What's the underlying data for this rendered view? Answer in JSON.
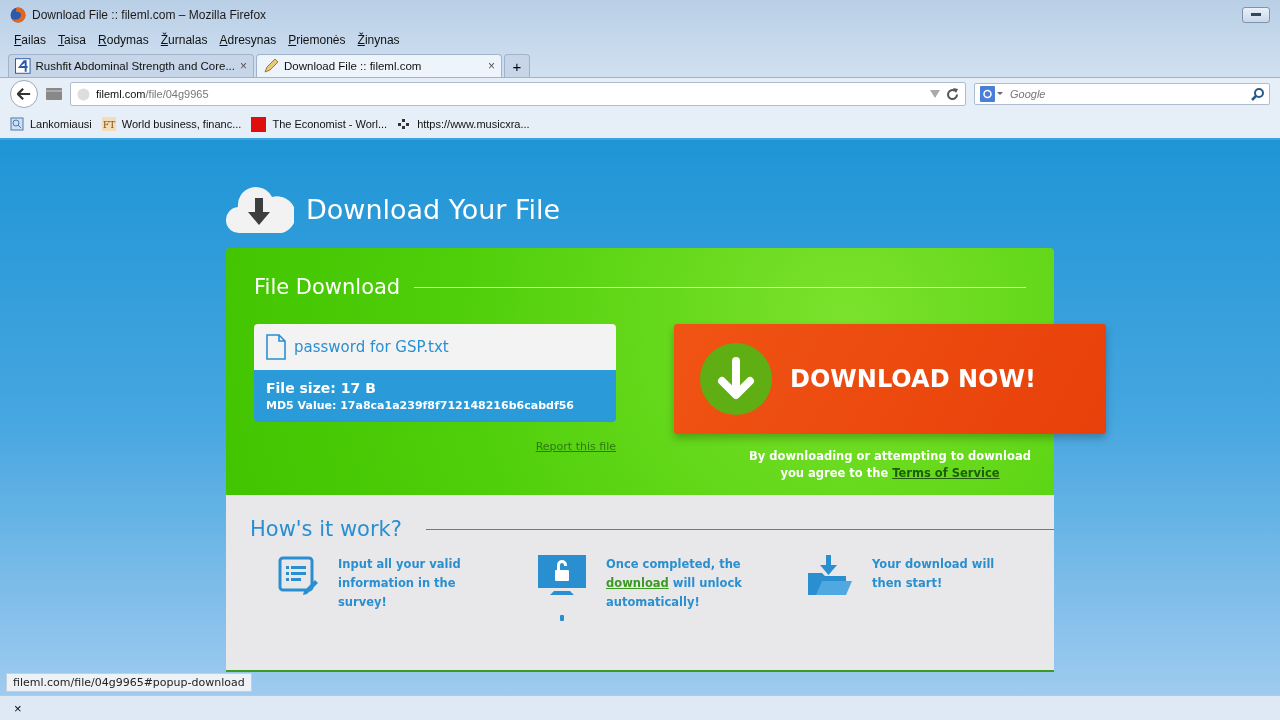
{
  "window": {
    "title": "Download File :: fileml.com – Mozilla Firefox"
  },
  "menu": [
    {
      "key": "F",
      "rest": "ailas"
    },
    {
      "key": "T",
      "rest": "aisa"
    },
    {
      "key": "R",
      "rest": "odymas"
    },
    {
      "key": "Ž",
      "rest": "urnalas"
    },
    {
      "key": "A",
      "rest": "dresynas"
    },
    {
      "key": "P",
      "rest": "riemonės"
    },
    {
      "key": "Ž",
      "rest": "inynas"
    }
  ],
  "tabs": [
    {
      "title": "Rushfit Abdominal Strength and Core...",
      "close": "×",
      "selected": false
    },
    {
      "title": "Download File :: fileml.com",
      "close": "×",
      "selected": true
    }
  ],
  "new_tab": "+",
  "address": {
    "host": "fileml.com",
    "path": "/file/04g9965"
  },
  "search": {
    "placeholder": "Google"
  },
  "bookmarks": [
    {
      "label": "Lankomiausi",
      "kind": "folder"
    },
    {
      "label": "World business, financ...",
      "kind": "ft",
      "icon_text": "FT"
    },
    {
      "label": "The Economist - Worl...",
      "kind": "square",
      "color": "#e00d0d"
    },
    {
      "label": "https://www.musicxra...",
      "kind": "dots"
    }
  ],
  "page": {
    "heading": "Download Your File",
    "panel_title": "File Download",
    "file": {
      "name": "password for GSP.txt",
      "size": "File size: 17 B",
      "md5": "MD5 Value: 17a8ca1a239f8f712148216b6cabdf56"
    },
    "report_link": "Report this file",
    "download_button": "DOWNLOAD NOW!",
    "terms": {
      "text": "By downloading or attempting to download you agree to the",
      "link": "Terms of Service"
    },
    "how_title": "How's it work?",
    "steps": [
      {
        "kind": "survey",
        "parts": [
          {
            "text": "Input all your valid information in the survey!",
            "link": false
          }
        ]
      },
      {
        "kind": "unlock",
        "parts": [
          {
            "text": "Once completed, the",
            "link": false
          },
          {
            "text": "download",
            "link": true
          },
          {
            "text": "will unlock automatically!",
            "link": false
          }
        ]
      },
      {
        "kind": "folder",
        "parts": [
          {
            "text": "Your download will then start!",
            "link": false
          }
        ]
      }
    ]
  },
  "status": {
    "url": "fileml.com/file/04g9965#popup-download",
    "close": "×"
  }
}
